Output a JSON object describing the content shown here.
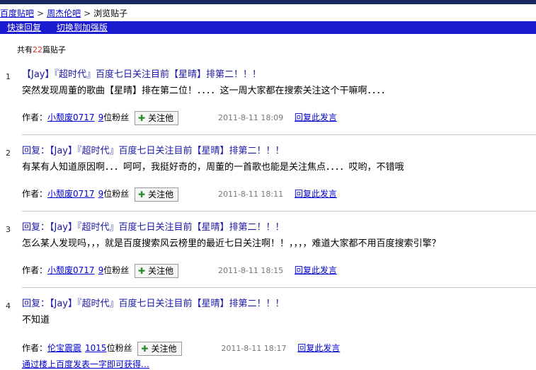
{
  "breadcrumb": {
    "items": [
      "百度贴吧",
      "周杰伦吧",
      "浏览贴子"
    ],
    "sep": ">"
  },
  "toolbar": {
    "quick_reply": "快速回复",
    "switch_enhanced": "切换到加强版"
  },
  "summary": {
    "prefix": "共有",
    "count": "22",
    "suffix": "篇贴子"
  },
  "follow_label": "关注他",
  "reply_label": "回复此发言",
  "author_label": "作者：",
  "posts": [
    {
      "no": "1",
      "title": "【Jay】『超时代』百度七日关注目前【星晴】排第二！！！",
      "body": "突然发现周董的歌曲【星晴】排在第二位！．．．．这一周大家都在搜索关注这个干嘛啊．．．．",
      "author": "小颓废0717",
      "fans": "9",
      "fans_suffix": "位粉丝",
      "time": "2011-8-11 18:09"
    },
    {
      "no": "2",
      "title": "回复：【Jay】『超时代』百度七日关注目前【星晴】排第二！！！",
      "body": "有某有人知道原因啊．．．呵呵，我挺好奇的，周董的一首歌也能是关注焦点．．．．哎哟，不错哦",
      "author": "小颓废0717",
      "fans": "9",
      "fans_suffix": "位粉丝",
      "time": "2011-8-11 18:11"
    },
    {
      "no": "3",
      "title": "回复：【Jay】『超时代』百度七日关注目前【星晴】排第二！！！",
      "body": "怎么某人发现吗，，，就是百度搜索风云榜里的最近七日关注啊！！，，，，难道大家都不用百度搜索引擎？",
      "author": "小颓废0717",
      "fans": "9",
      "fans_suffix": "位粉丝",
      "time": "2011-8-11 18:15"
    },
    {
      "no": "4",
      "title": "回复：【Jay】『超时代』百度七日关注目前【星晴】排第二！！！",
      "body": "不知道",
      "author": "伦宝震震",
      "fans": "1015",
      "fans_suffix": "位粉丝",
      "time": "2011-8-11 18:17"
    }
  ],
  "cutoff_text": "通过楼上百度发表一字即可获得…"
}
